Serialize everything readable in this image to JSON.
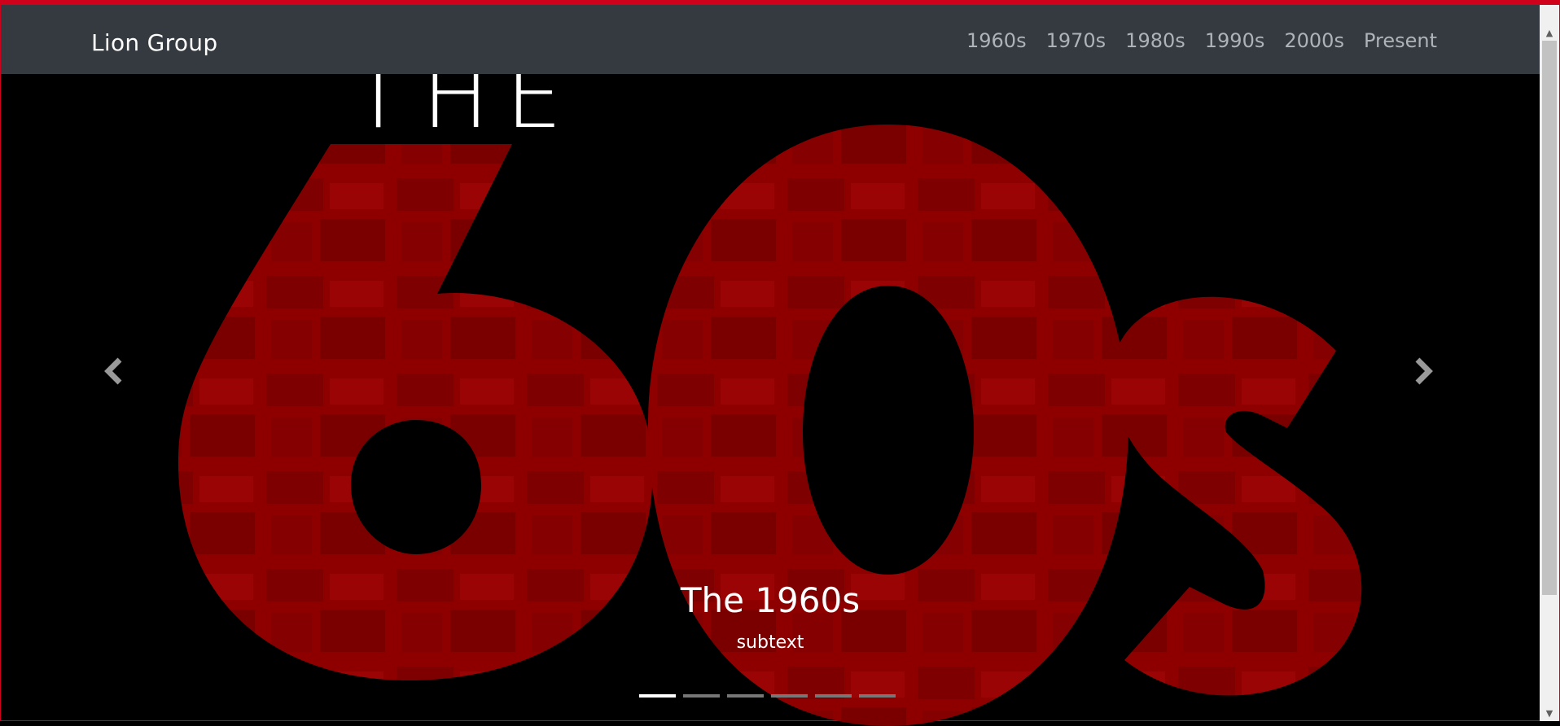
{
  "nav": {
    "brand": "Lion Group",
    "links": [
      "1960s",
      "1970s",
      "1980s",
      "1990s",
      "2000s",
      "Present"
    ]
  },
  "hero": {
    "art_text_small": "THE",
    "art_text_big": "60s",
    "caption_title": "The 1960s",
    "caption_sub": "subtext"
  },
  "carousel": {
    "indicator_count": 6,
    "active_index": 0,
    "prev_icon": "chevron-left-icon",
    "next_icon": "chevron-right-icon"
  },
  "colors": {
    "navbar": "#343a40",
    "nav_link": "#aeb3b8",
    "brand_text": "#ffffff",
    "hero_red": "#8b0000",
    "background": "#000000"
  }
}
